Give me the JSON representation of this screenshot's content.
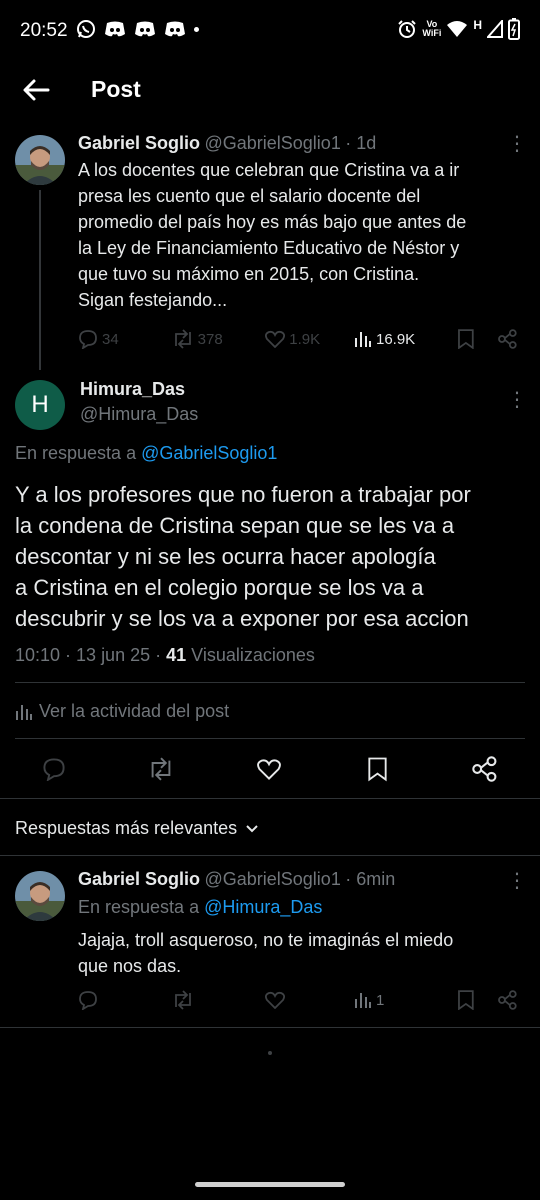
{
  "status_bar": {
    "time": "20:52",
    "left_icons": [
      "whatsapp-icon",
      "discord-icon",
      "discord-icon",
      "discord-icon",
      "dot-icon"
    ],
    "right_icons": [
      "alarm-icon",
      "vowifi-icon",
      "wifi-icon",
      "h-signal-icon",
      "signal-icon",
      "battery-icon"
    ],
    "vo_label": "Vo",
    "wifi_label": "WiFi",
    "h_label": "H"
  },
  "header": {
    "title": "Post"
  },
  "parent_post": {
    "name": "Gabriel Soglio",
    "handle": "@GabrielSoglio1",
    "time": "· 1d",
    "lines": [
      "A los docentes que celebran que Cristina va a ir",
      "presa les cuento que el salario docente del",
      "promedio del país hoy es más bajo que antes de",
      "la Ley de Financiamiento Educativo de Néstor y",
      "que tuvo su máximo en 2015, con Cristina.",
      "Sigan festejando..."
    ],
    "replies": "34",
    "reposts": "378",
    "likes": "1.9K",
    "views": "16.9K"
  },
  "main_post": {
    "avatar_letter": "H",
    "name": "Himura_Das",
    "handle": "@Himura_Das",
    "reply_prefix": "En respuesta a",
    "reply_to": "@GabrielSoglio1",
    "lines": [
      "Y a los profesores que no fueron a trabajar por",
      "la condena de Cristina sepan que se les va a",
      "descontar y ni se les ocurra hacer apología",
      "a Cristina en el colegio porque se los va a",
      "descubrir y se los va a exponer por esa accion"
    ],
    "timestamp": "10:10 · 13 jun 25 ·",
    "views_count": "41",
    "views_label": "Visualizaciones",
    "activity_label": "Ver la actividad del post"
  },
  "replies_section": {
    "sort_label": "Respuestas más relevantes"
  },
  "reply_post": {
    "name": "Gabriel Soglio",
    "handle": "@GabrielSoglio1",
    "time": "· 6min",
    "reply_prefix": "En respuesta a",
    "reply_to": "@Himura_Das",
    "lines": [
      "Jajaja, troll asqueroso, no te imaginás el miedo",
      "que nos das."
    ],
    "views": "1"
  },
  "colors": {
    "background": "#000000",
    "text": "#e7e9ea",
    "muted": "#71767b",
    "link": "#1d9bf0",
    "avatar_h": "#0f5c48"
  }
}
